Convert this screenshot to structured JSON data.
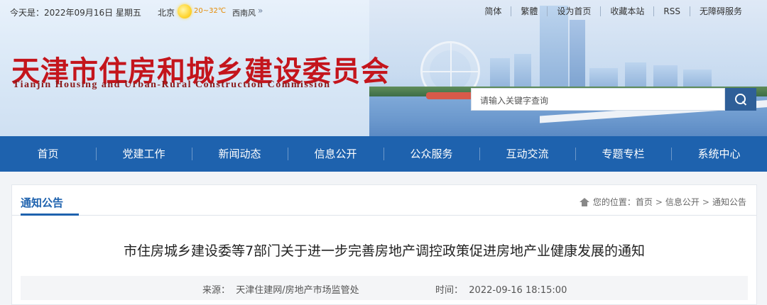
{
  "top_bar": {
    "date": "今天是：2022年09月16日 星期五",
    "city": "北京",
    "temperature": "20~32℃",
    "wind": "西南风",
    "wind_arrow": "»",
    "links": [
      "简体",
      "繁體",
      "设为首页",
      "收藏本站",
      "RSS",
      "无障碍服务"
    ]
  },
  "logo": {
    "title_cn": "天津市住房和城乡建设委员会",
    "title_en": "Tianjin Housing and Urban-Rural Construction Commission"
  },
  "search": {
    "placeholder": "请输入关键字查询"
  },
  "nav": [
    "首页",
    "党建工作",
    "新闻动态",
    "信息公开",
    "公众服务",
    "互动交流",
    "专题专栏",
    "系统中心"
  ],
  "section": {
    "tab": "通知公告",
    "breadcrumb": {
      "prefix": "您的位置：",
      "items": [
        "首页",
        "信息公开",
        "通知公告"
      ],
      "separator": ">"
    }
  },
  "article": {
    "title": "市住房城乡建设委等7部门关于进一步完善房地产调控政策促进房地产业健康发展的通知",
    "source_label": "来源：",
    "source": "天津住建网/房地产市场监管处",
    "time_label": "时间：",
    "time": "2022-09-16 18:15:00"
  },
  "colors": {
    "logo_red": "#c4151c",
    "nav_blue": "#1e62ae",
    "search_button": "#2f5f98"
  }
}
